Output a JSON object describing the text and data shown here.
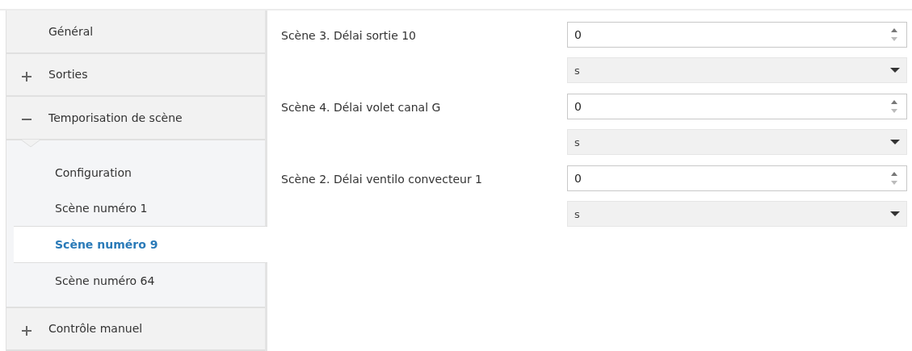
{
  "sidebar": {
    "items": [
      {
        "kind": "page",
        "label": "Général",
        "selected": false
      },
      {
        "kind": "group",
        "label": "Sorties",
        "expanded": false,
        "selected": false
      },
      {
        "kind": "group",
        "label": "Temporisation de scène",
        "expanded": true,
        "selected": false,
        "children": [
          {
            "label": "Configuration",
            "selected": false
          },
          {
            "label": "Scène numéro 1",
            "selected": false
          },
          {
            "label": "Scène numéro 9",
            "selected": true
          },
          {
            "label": "Scène numéro 64",
            "selected": false
          }
        ]
      },
      {
        "kind": "group",
        "label": "Contrôle manuel",
        "expanded": false,
        "selected": false
      }
    ]
  },
  "parameters": [
    {
      "label": "Scène 3. Délai sortie 10",
      "value": "0",
      "unit": "s"
    },
    {
      "label": "Scène 4. Délai volet canal G",
      "value": "0",
      "unit": "s"
    },
    {
      "label": "Scène 2. Délai ventilo convecteur 1",
      "value": "0",
      "unit": "s"
    }
  ]
}
